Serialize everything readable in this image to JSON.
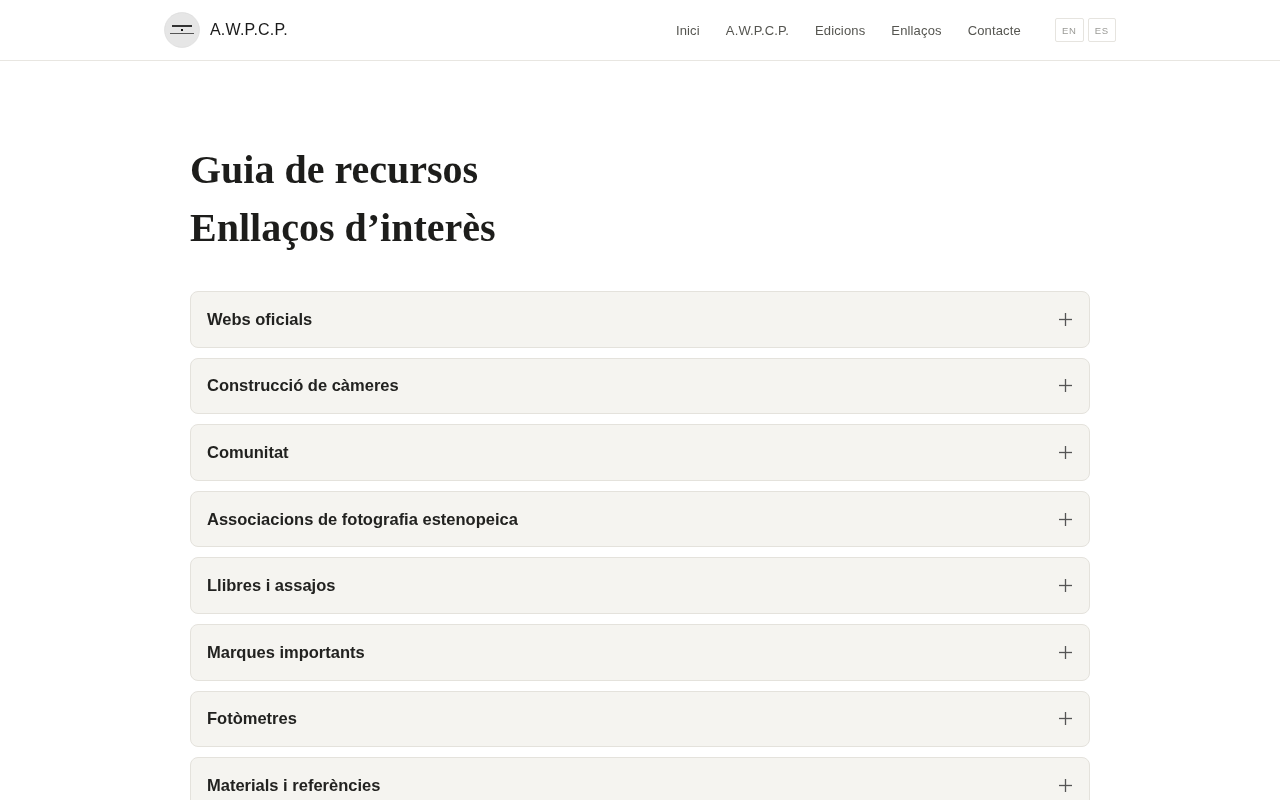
{
  "header": {
    "brand": "A.W.P.C.P.",
    "nav": [
      "Inici",
      "A.W.P.C.P.",
      "Edicions",
      "Enllaços",
      "Contacte"
    ],
    "languages": [
      "EN",
      "ES"
    ]
  },
  "page": {
    "titles": [
      "Guia de recursos",
      "Enllaços d’interès"
    ]
  },
  "accordion": [
    {
      "title": "Webs oficials",
      "expanded": false
    },
    {
      "title": "Construcció de càmeres",
      "expanded": false
    },
    {
      "title": "Comunitat",
      "expanded": false
    },
    {
      "title": "Associacions de fotografia estenopeica",
      "expanded": false
    },
    {
      "title": "Llibres i assajos",
      "expanded": false
    },
    {
      "title": "Marques importants",
      "expanded": false
    },
    {
      "title": "Fotòmetres",
      "expanded": false
    },
    {
      "title": "Materials i referències",
      "expanded": false
    }
  ]
}
